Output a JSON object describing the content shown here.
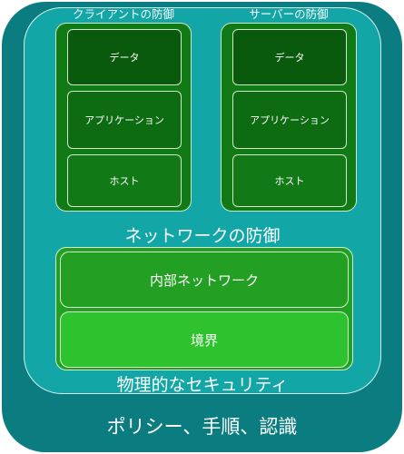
{
  "outer_layer": {
    "label": "ポリシー、手順、認識"
  },
  "physical_layer": {
    "label": "物理的なセキュリティ"
  },
  "network_layer": {
    "label": "ネットワークの防御"
  },
  "client_stack": {
    "title": "クライアントの防御",
    "items": [
      "データ",
      "アプリケーション",
      "ホスト"
    ]
  },
  "server_stack": {
    "title": "サーバーの防御",
    "items": [
      "データ",
      "アプリケーション",
      "ホスト"
    ]
  },
  "inner_network": {
    "items": [
      "内部ネットワーク",
      "境界"
    ]
  },
  "colors": {
    "outer": "#0b7d80",
    "physical": "#13a6a6",
    "stack_bg": "#117a17",
    "data_box": "#0a5a0e",
    "app_box": "#0d6c12",
    "internal_network": "#23a023",
    "perimeter": "#2fc22f",
    "text": "#ffffff"
  }
}
